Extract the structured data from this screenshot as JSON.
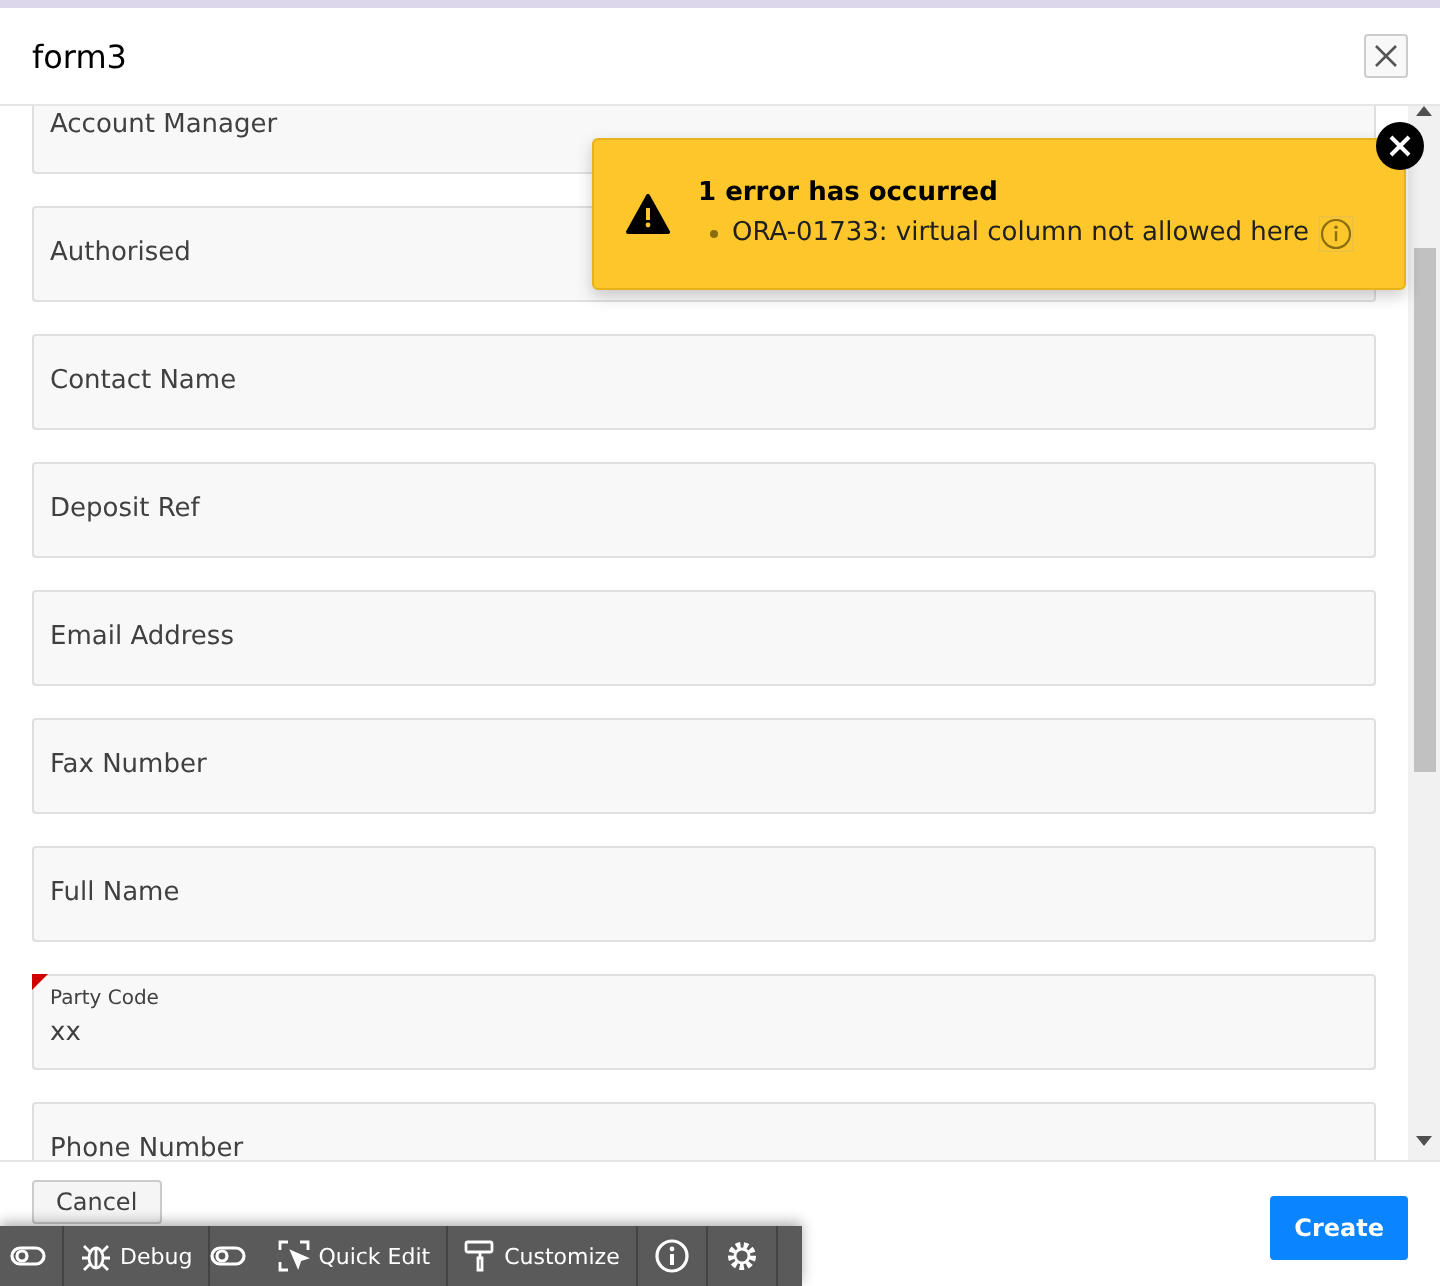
{
  "dialog": {
    "title": "form3"
  },
  "fields": [
    {
      "label": "Account Manager",
      "error": false
    },
    {
      "label": "Authorised",
      "error": false
    },
    {
      "label": "Contact Name",
      "error": false
    },
    {
      "label": "Deposit Ref",
      "error": false
    },
    {
      "label": "Email Address",
      "error": false
    },
    {
      "label": "Fax Number",
      "error": false
    },
    {
      "label": "Full Name",
      "error": false
    },
    {
      "label": "Party Code",
      "value": "xx",
      "error": true
    },
    {
      "label": "Phone Number",
      "error": false
    }
  ],
  "notification": {
    "title": "1 error has occurred",
    "messages": [
      "ORA-01733: virtual column not allowed here"
    ]
  },
  "buttons": {
    "cancel": "Cancel",
    "create": "Create"
  },
  "dev_toolbar": [
    {
      "kind": "toggle"
    },
    {
      "kind": "debug",
      "label": "Debug"
    },
    {
      "kind": "toggle"
    },
    {
      "kind": "quickedit",
      "label": "Quick Edit"
    },
    {
      "kind": "customize",
      "label": "Customize"
    },
    {
      "kind": "info"
    },
    {
      "kind": "gear"
    }
  ]
}
